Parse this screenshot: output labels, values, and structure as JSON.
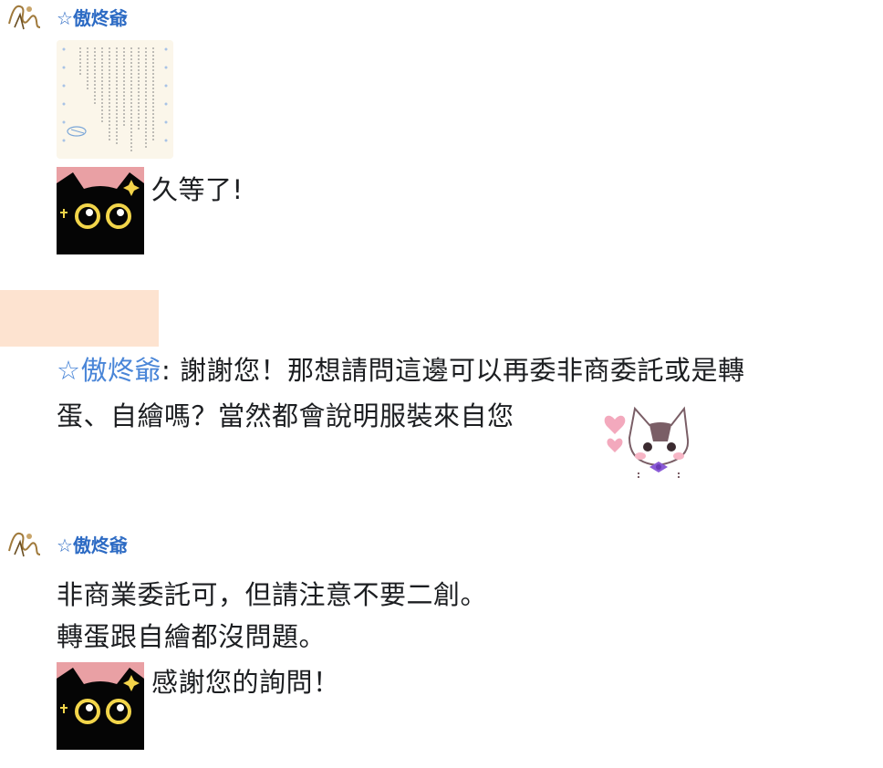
{
  "post1": {
    "author": "☆傲炵爺",
    "caption": "久等了!"
  },
  "reply": {
    "name": "☆傲炵爺",
    "separator": ": ",
    "line1": "謝謝您！那想請問這邊可以再委非商委託或是轉",
    "line2": "蛋、自繪嗎？當然都會說明服裝來自您"
  },
  "post2": {
    "author": "☆傲炵爺",
    "line1": "非商業委託可，但請注意不要二創。",
    "line2": "轉蛋跟自繪都沒問題。",
    "line3": "感謝您的詢問！"
  },
  "colors": {
    "author": "#2d6bc4",
    "quote_name": "#4a86d8",
    "highlight": "#fde3d0"
  },
  "icons": [
    "avatar-sketch-icon",
    "cat-sticker-icon",
    "heart-cat-sticker-icon",
    "rules-paper-image"
  ]
}
